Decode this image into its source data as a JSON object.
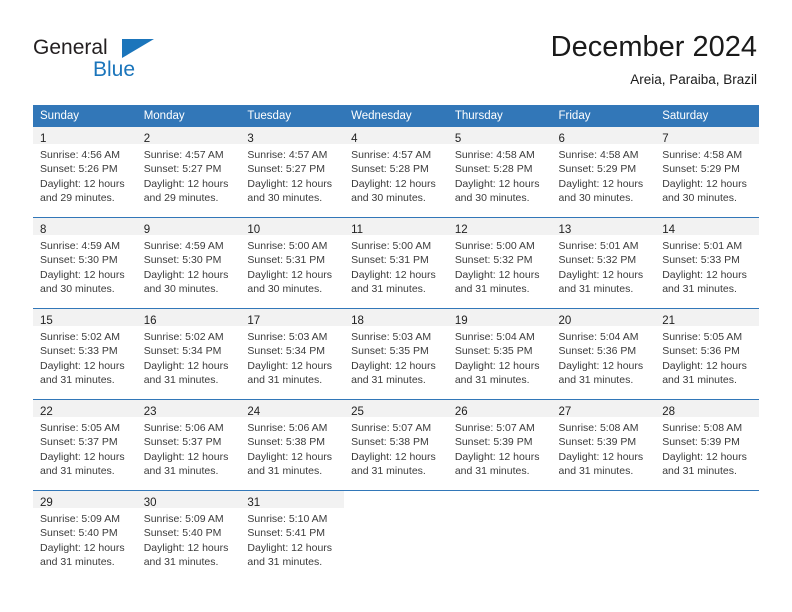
{
  "brand": {
    "word_one": "General",
    "word_two": "Blue",
    "triangle_icon": "blue-triangle-icon",
    "accent_color": "#1b75bb"
  },
  "header": {
    "title": "December 2024",
    "subtitle": "Areia, Paraiba, Brazil"
  },
  "theme": {
    "header_row_color": "#3277b8",
    "daynum_band_color": "#f2f2f2",
    "row_divider_color": "#3277b8"
  },
  "weekday_headers": [
    "Sunday",
    "Monday",
    "Tuesday",
    "Wednesday",
    "Thursday",
    "Friday",
    "Saturday"
  ],
  "weeks": [
    {
      "days": [
        {
          "day": "1",
          "sunrise": "Sunrise: 4:56 AM",
          "sunset": "Sunset: 5:26 PM",
          "daylight_line1": "Daylight: 12 hours",
          "daylight_line2": "and 29 minutes."
        },
        {
          "day": "2",
          "sunrise": "Sunrise: 4:57 AM",
          "sunset": "Sunset: 5:27 PM",
          "daylight_line1": "Daylight: 12 hours",
          "daylight_line2": "and 29 minutes."
        },
        {
          "day": "3",
          "sunrise": "Sunrise: 4:57 AM",
          "sunset": "Sunset: 5:27 PM",
          "daylight_line1": "Daylight: 12 hours",
          "daylight_line2": "and 30 minutes."
        },
        {
          "day": "4",
          "sunrise": "Sunrise: 4:57 AM",
          "sunset": "Sunset: 5:28 PM",
          "daylight_line1": "Daylight: 12 hours",
          "daylight_line2": "and 30 minutes."
        },
        {
          "day": "5",
          "sunrise": "Sunrise: 4:58 AM",
          "sunset": "Sunset: 5:28 PM",
          "daylight_line1": "Daylight: 12 hours",
          "daylight_line2": "and 30 minutes."
        },
        {
          "day": "6",
          "sunrise": "Sunrise: 4:58 AM",
          "sunset": "Sunset: 5:29 PM",
          "daylight_line1": "Daylight: 12 hours",
          "daylight_line2": "and 30 minutes."
        },
        {
          "day": "7",
          "sunrise": "Sunrise: 4:58 AM",
          "sunset": "Sunset: 5:29 PM",
          "daylight_line1": "Daylight: 12 hours",
          "daylight_line2": "and 30 minutes."
        }
      ]
    },
    {
      "days": [
        {
          "day": "8",
          "sunrise": "Sunrise: 4:59 AM",
          "sunset": "Sunset: 5:30 PM",
          "daylight_line1": "Daylight: 12 hours",
          "daylight_line2": "and 30 minutes."
        },
        {
          "day": "9",
          "sunrise": "Sunrise: 4:59 AM",
          "sunset": "Sunset: 5:30 PM",
          "daylight_line1": "Daylight: 12 hours",
          "daylight_line2": "and 30 minutes."
        },
        {
          "day": "10",
          "sunrise": "Sunrise: 5:00 AM",
          "sunset": "Sunset: 5:31 PM",
          "daylight_line1": "Daylight: 12 hours",
          "daylight_line2": "and 30 minutes."
        },
        {
          "day": "11",
          "sunrise": "Sunrise: 5:00 AM",
          "sunset": "Sunset: 5:31 PM",
          "daylight_line1": "Daylight: 12 hours",
          "daylight_line2": "and 31 minutes."
        },
        {
          "day": "12",
          "sunrise": "Sunrise: 5:00 AM",
          "sunset": "Sunset: 5:32 PM",
          "daylight_line1": "Daylight: 12 hours",
          "daylight_line2": "and 31 minutes."
        },
        {
          "day": "13",
          "sunrise": "Sunrise: 5:01 AM",
          "sunset": "Sunset: 5:32 PM",
          "daylight_line1": "Daylight: 12 hours",
          "daylight_line2": "and 31 minutes."
        },
        {
          "day": "14",
          "sunrise": "Sunrise: 5:01 AM",
          "sunset": "Sunset: 5:33 PM",
          "daylight_line1": "Daylight: 12 hours",
          "daylight_line2": "and 31 minutes."
        }
      ]
    },
    {
      "days": [
        {
          "day": "15",
          "sunrise": "Sunrise: 5:02 AM",
          "sunset": "Sunset: 5:33 PM",
          "daylight_line1": "Daylight: 12 hours",
          "daylight_line2": "and 31 minutes."
        },
        {
          "day": "16",
          "sunrise": "Sunrise: 5:02 AM",
          "sunset": "Sunset: 5:34 PM",
          "daylight_line1": "Daylight: 12 hours",
          "daylight_line2": "and 31 minutes."
        },
        {
          "day": "17",
          "sunrise": "Sunrise: 5:03 AM",
          "sunset": "Sunset: 5:34 PM",
          "daylight_line1": "Daylight: 12 hours",
          "daylight_line2": "and 31 minutes."
        },
        {
          "day": "18",
          "sunrise": "Sunrise: 5:03 AM",
          "sunset": "Sunset: 5:35 PM",
          "daylight_line1": "Daylight: 12 hours",
          "daylight_line2": "and 31 minutes."
        },
        {
          "day": "19",
          "sunrise": "Sunrise: 5:04 AM",
          "sunset": "Sunset: 5:35 PM",
          "daylight_line1": "Daylight: 12 hours",
          "daylight_line2": "and 31 minutes."
        },
        {
          "day": "20",
          "sunrise": "Sunrise: 5:04 AM",
          "sunset": "Sunset: 5:36 PM",
          "daylight_line1": "Daylight: 12 hours",
          "daylight_line2": "and 31 minutes."
        },
        {
          "day": "21",
          "sunrise": "Sunrise: 5:05 AM",
          "sunset": "Sunset: 5:36 PM",
          "daylight_line1": "Daylight: 12 hours",
          "daylight_line2": "and 31 minutes."
        }
      ]
    },
    {
      "days": [
        {
          "day": "22",
          "sunrise": "Sunrise: 5:05 AM",
          "sunset": "Sunset: 5:37 PM",
          "daylight_line1": "Daylight: 12 hours",
          "daylight_line2": "and 31 minutes."
        },
        {
          "day": "23",
          "sunrise": "Sunrise: 5:06 AM",
          "sunset": "Sunset: 5:37 PM",
          "daylight_line1": "Daylight: 12 hours",
          "daylight_line2": "and 31 minutes."
        },
        {
          "day": "24",
          "sunrise": "Sunrise: 5:06 AM",
          "sunset": "Sunset: 5:38 PM",
          "daylight_line1": "Daylight: 12 hours",
          "daylight_line2": "and 31 minutes."
        },
        {
          "day": "25",
          "sunrise": "Sunrise: 5:07 AM",
          "sunset": "Sunset: 5:38 PM",
          "daylight_line1": "Daylight: 12 hours",
          "daylight_line2": "and 31 minutes."
        },
        {
          "day": "26",
          "sunrise": "Sunrise: 5:07 AM",
          "sunset": "Sunset: 5:39 PM",
          "daylight_line1": "Daylight: 12 hours",
          "daylight_line2": "and 31 minutes."
        },
        {
          "day": "27",
          "sunrise": "Sunrise: 5:08 AM",
          "sunset": "Sunset: 5:39 PM",
          "daylight_line1": "Daylight: 12 hours",
          "daylight_line2": "and 31 minutes."
        },
        {
          "day": "28",
          "sunrise": "Sunrise: 5:08 AM",
          "sunset": "Sunset: 5:39 PM",
          "daylight_line1": "Daylight: 12 hours",
          "daylight_line2": "and 31 minutes."
        }
      ]
    },
    {
      "days": [
        {
          "day": "29",
          "sunrise": "Sunrise: 5:09 AM",
          "sunset": "Sunset: 5:40 PM",
          "daylight_line1": "Daylight: 12 hours",
          "daylight_line2": "and 31 minutes."
        },
        {
          "day": "30",
          "sunrise": "Sunrise: 5:09 AM",
          "sunset": "Sunset: 5:40 PM",
          "daylight_line1": "Daylight: 12 hours",
          "daylight_line2": "and 31 minutes."
        },
        {
          "day": "31",
          "sunrise": "Sunrise: 5:10 AM",
          "sunset": "Sunset: 5:41 PM",
          "daylight_line1": "Daylight: 12 hours",
          "daylight_line2": "and 31 minutes."
        },
        {
          "day": "",
          "sunrise": "",
          "sunset": "",
          "daylight_line1": "",
          "daylight_line2": ""
        },
        {
          "day": "",
          "sunrise": "",
          "sunset": "",
          "daylight_line1": "",
          "daylight_line2": ""
        },
        {
          "day": "",
          "sunrise": "",
          "sunset": "",
          "daylight_line1": "",
          "daylight_line2": ""
        },
        {
          "day": "",
          "sunrise": "",
          "sunset": "",
          "daylight_line1": "",
          "daylight_line2": ""
        }
      ]
    }
  ]
}
